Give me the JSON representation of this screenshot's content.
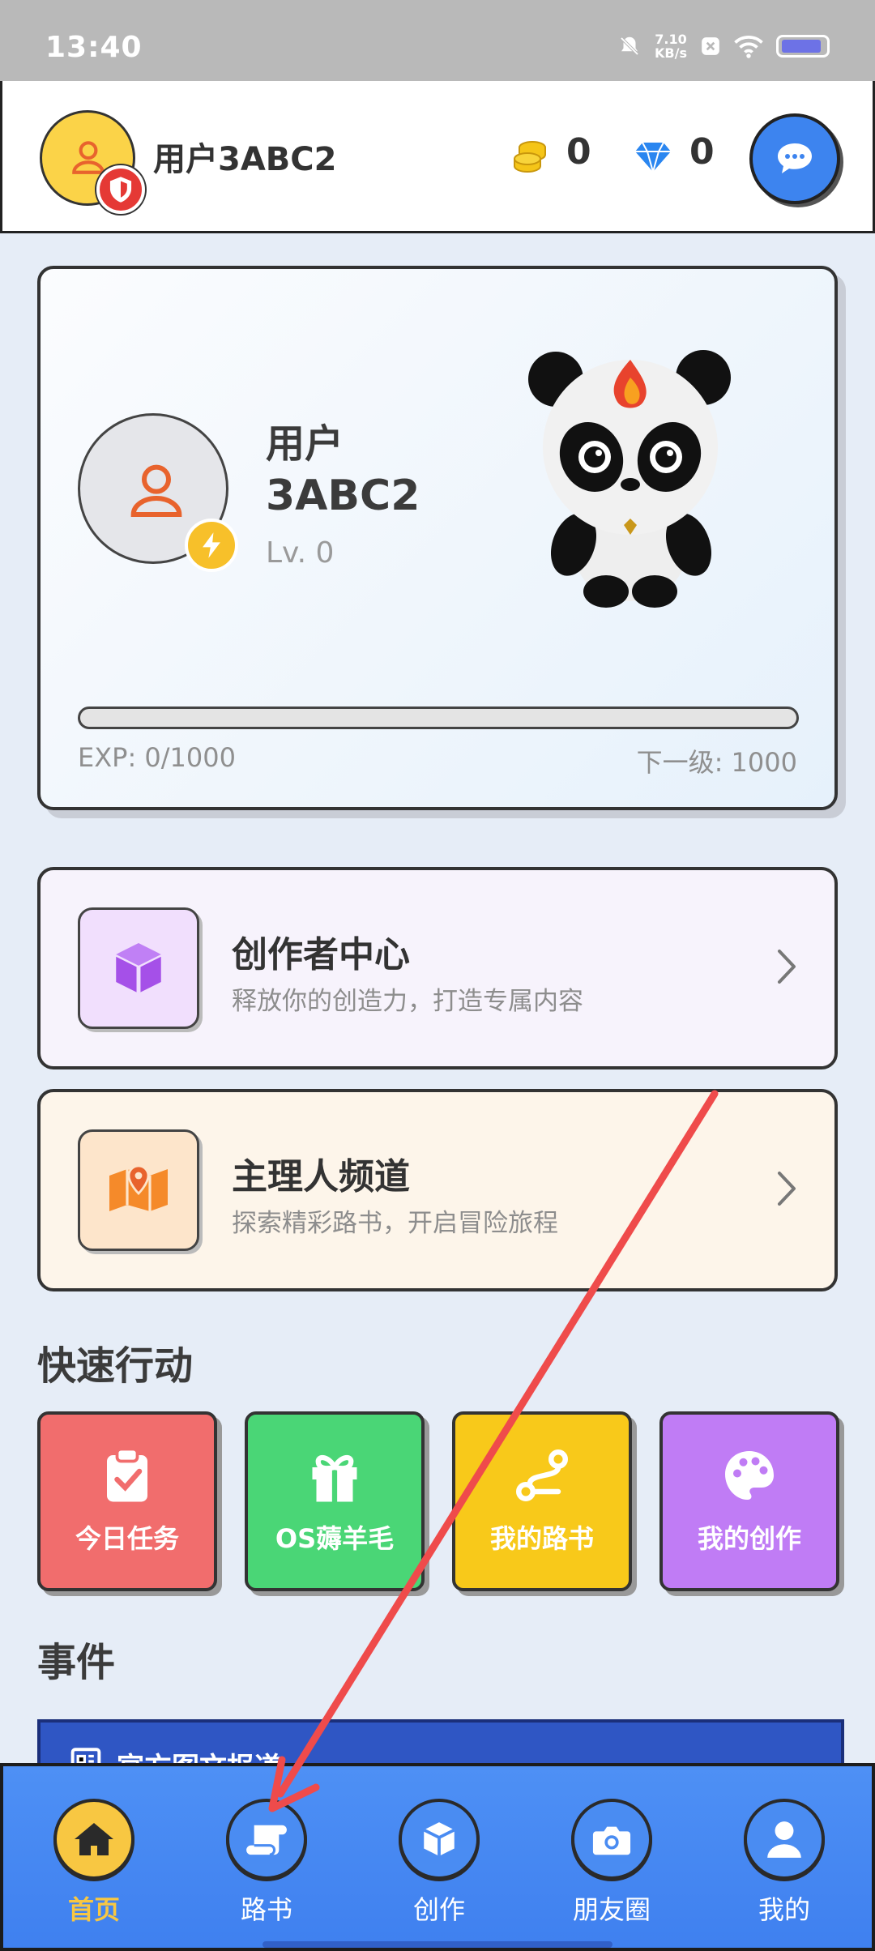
{
  "status_bar": {
    "time": "13:40",
    "net_speed_value": "7.10",
    "net_speed_unit": "KB/s"
  },
  "header": {
    "username": "用户3ABC2",
    "coins": "0",
    "gems": "0"
  },
  "profile": {
    "name_line1": "用户",
    "name_line2": "3ABC2",
    "level": "Lv. 0",
    "exp_text": "EXP: 0/1000",
    "next_level_text": "下一级: 1000",
    "exp_progress": 0
  },
  "features": [
    {
      "title": "创作者中心",
      "subtitle": "释放你的创造力，打造专属内容"
    },
    {
      "title": "主理人频道",
      "subtitle": "探索精彩路书，开启冒险旅程"
    }
  ],
  "quick_actions": {
    "title": "快速行动",
    "items": [
      {
        "label": "今日任务",
        "color": "#f16d6d",
        "icon": "clipboard-check-icon"
      },
      {
        "label": "OS薅羊毛",
        "color": "#4ad676",
        "icon": "gift-icon"
      },
      {
        "label": "我的路书",
        "color": "#f8c91a",
        "icon": "route-icon"
      },
      {
        "label": "我的创作",
        "color": "#c07cf5",
        "icon": "palette-icon"
      }
    ]
  },
  "events": {
    "title": "事件",
    "banner_title": "官方图文报道"
  },
  "nav": {
    "items": [
      {
        "label": "首页",
        "icon": "home-icon",
        "active": true
      },
      {
        "label": "路书",
        "icon": "scroll-icon"
      },
      {
        "label": "创作",
        "icon": "cube-icon"
      },
      {
        "label": "朋友圈",
        "icon": "camera-icon"
      },
      {
        "label": "我的",
        "icon": "user-icon"
      }
    ]
  },
  "colors": {
    "accent_blue": "#3f80ef",
    "active_yellow": "#f8c742",
    "annotation_red": "#ef4b4b"
  }
}
